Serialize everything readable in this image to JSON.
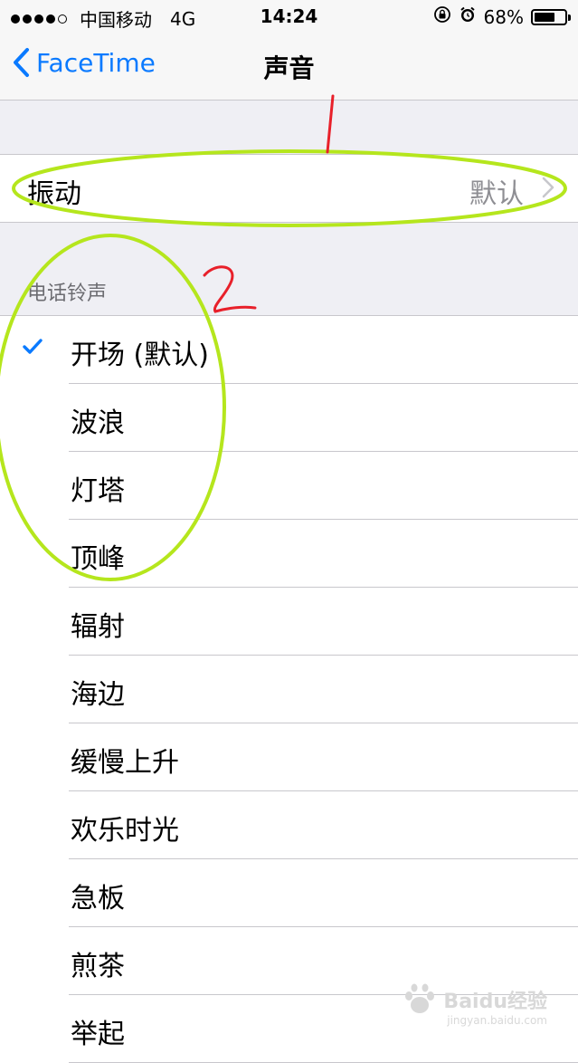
{
  "status_bar": {
    "carrier": "中国移动",
    "network": "4G",
    "time": "14:24",
    "battery_percent_text": "68%",
    "battery_level": 0.68,
    "icons": [
      "rotation-lock-icon",
      "alarm-icon",
      "battery-icon"
    ]
  },
  "nav": {
    "back_label": "FaceTime",
    "title": "声音"
  },
  "vibration": {
    "label": "振动",
    "value": "默认"
  },
  "ringtones": {
    "header": "电话铃声",
    "items": [
      {
        "label": "开场 (默认)",
        "selected": true
      },
      {
        "label": "波浪",
        "selected": false
      },
      {
        "label": "灯塔",
        "selected": false
      },
      {
        "label": "顶峰",
        "selected": false
      },
      {
        "label": "辐射",
        "selected": false
      },
      {
        "label": "海边",
        "selected": false
      },
      {
        "label": "缓慢上升",
        "selected": false
      },
      {
        "label": "欢乐时光",
        "selected": false
      },
      {
        "label": "急板",
        "selected": false
      },
      {
        "label": "煎茶",
        "selected": false
      },
      {
        "label": "举起",
        "selected": false
      }
    ]
  },
  "annotations": {
    "marker_1": "1",
    "marker_2": "2",
    "ellipse_color": "#b5e61d",
    "marker_color": "#e8202a"
  },
  "watermark": {
    "brand": "Baidu经验",
    "url": "jingyan.baidu.com"
  },
  "colors": {
    "accent": "#0a7aff",
    "background": "#efeff4",
    "separator": "#c8c7cc",
    "secondary_text": "#8e8e93"
  }
}
